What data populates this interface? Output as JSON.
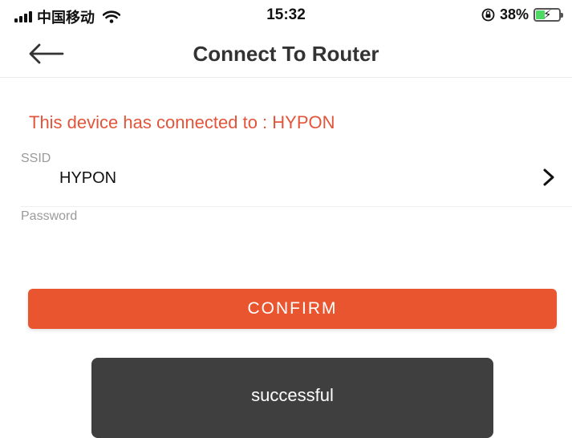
{
  "status_bar": {
    "carrier": "中国移动",
    "time": "15:32",
    "battery_percent": "38%",
    "battery_level": 0.38,
    "icons": [
      "signal-bars-icon",
      "wifi-icon",
      "orientation-lock-icon",
      "battery-charging-icon"
    ],
    "battery_color": "#4cd964"
  },
  "navbar": {
    "title": "Connect To Router",
    "back_icon": "arrow-left-icon"
  },
  "main": {
    "connected_message": "This device has connected to : HYPON",
    "ssid_label": "SSID",
    "ssid_value": "HYPON",
    "ssid_chevron_icon": "chevron-right-icon",
    "password_label": "Password",
    "password_value": "",
    "confirm_label": "CONFIRM"
  },
  "toast": {
    "message": "successful"
  },
  "colors": {
    "accent": "#e9552f",
    "message_text": "#e2553a",
    "toast_bg": "#3f3f3f"
  }
}
